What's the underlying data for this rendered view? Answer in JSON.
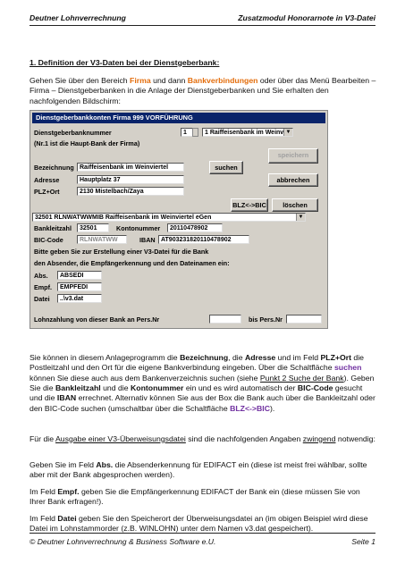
{
  "header": {
    "left": "Deutner Lohnverrechnung",
    "right": "Zusatzmodul Honorarnote in V3-Datei"
  },
  "section_title": "1. Definition der V3-Daten bei der Dienstgeberbank:",
  "intro": {
    "t1": "Gehen Sie über den Bereich ",
    "firma": "Firma",
    "t2": " und dann ",
    "bankverbindungen": "Bankverbindungen",
    "t3": " oder über das Menü Bearbeiten – Firma – Dienstgeberbanken in die Anlage der Dienstgeberbanken und Sie erhalten den nachfolgenden Bildschirm:"
  },
  "dialog": {
    "title": "Dienstgeberbankkonten Firma 999  VORFÜHRUNG",
    "nummer_label": "Dienstgeberbanknummer",
    "nummer_value": "1",
    "bank_select": "1    Raiffeisenbank im Weinv",
    "note": "(Nr.1 ist die Haupt-Bank der Firma)",
    "speichern": "speichern",
    "bez_label": "Bezeichnung",
    "bez_value": "Raiffeisenbank im Weinviertel",
    "suchen": "suchen",
    "adr_label": "Adresse",
    "adr_value": "Hauptplatz 37",
    "abbrechen": "abbrechen",
    "plz_label": "PLZ+Ort",
    "plz_value": "2130 Mistelbach/Zaya",
    "blz_bic": "BLZ<->BIC",
    "loeschen": "löschen",
    "bankbox": "32501 RLNWATWWMIB Raiffeisenbank im Weinviertel eGen",
    "blz_label": "Bankleitzahl",
    "blz_value": "32501",
    "kto_label": "Kontonummer",
    "kto_value": "20110478902",
    "bic_label": "BIC-Code",
    "bic_value": "RLNWATWW",
    "iban_label": "IBAN",
    "iban_value": "AT903231820110478902",
    "bitte1": "Bitte geben Sie zur Erstellung einer V3-Datei für die Bank",
    "bitte2": "den Absender, die Empfängerkennung und den Dateinamen ein:",
    "abs_label": "Abs.",
    "abs_value": "ABSEDI",
    "empf_label": "Empf.",
    "empf_value": "EMPFEDI",
    "datei_label": "Datei",
    "datei_value": "..\\v3.dat",
    "lohn_label": "Lohnzahlung von dieser Bank an Pers.Nr",
    "bis_label": "bis Pers.Nr"
  },
  "para_after": {
    "t1": "Sie können in diesem Anlageprogramm die ",
    "b1": "Bezeichnung",
    "t2": ", die ",
    "b2": "Adresse",
    "t3": " und im Feld ",
    "b3": "PLZ+Ort",
    "t4": " die Postleitzahl und den Ort für die eigene Bankverbindung eingeben. Über die Schaltfläche ",
    "suchen": "suchen",
    "t5": " können Sie diese auch aus dem Bankenverzeichnis suchen (siehe ",
    "link": "Punkt 2 Suche der Bank",
    "t6": "). Geben Sie die ",
    "b4": "Bankleitzahl",
    "t7": " und die ",
    "b5": "Kontonummer",
    "t8": " ein und es wird automatisch der ",
    "b6": "BIC-Code",
    "t9": " gesucht und die ",
    "b7": "IBAN",
    "t10": " errechnet. Alternativ können Sie aus der Box die Bank auch über die Bankleitzahl oder den BIC-Code suchen (umschaltbar über die Schaltfläche ",
    "blzbic": "BLZ<->BIC",
    "t11": ")."
  },
  "para2": {
    "t1": "Für die ",
    "link": "Ausgabe einer V3-Überweisungsdatei",
    "t2": " sind die nachfolgenden Angaben ",
    "zw": "zwingend",
    "t3": " notwendig:"
  },
  "para3": {
    "t1": "Geben Sie im Feld ",
    "b": "Abs.",
    "t2": " die Absenderkennung für EDIFACT ein (diese ist meist frei wählbar, sollte aber mit der Bank abgesprochen werden)."
  },
  "para4": {
    "t1": "Im Feld ",
    "b": "Empf.",
    "t2": " geben Sie die Empfängerkennung EDIFACT der Bank ein (diese müssen Sie von Ihrer Bank erfragen!)."
  },
  "para5": {
    "t1": "Im Feld ",
    "b": "Datei",
    "t2": " geben Sie den Speicherort der Überweisungsdatei an (im obigen Beispiel wird diese Datei im Lohnstammorder (z.B. WINLOHN) unter dem Namen v3.dat gespeichert)."
  },
  "footer": {
    "left": "© Deutner Lohnverrechnung & Business Software e.U.",
    "right": "Seite 1"
  }
}
